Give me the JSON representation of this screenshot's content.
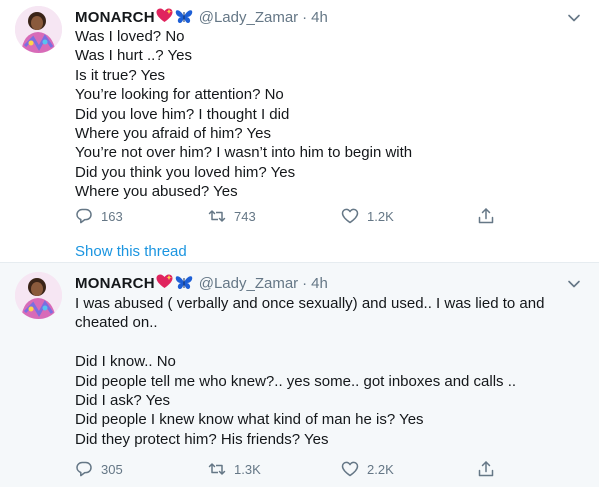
{
  "tweets": [
    {
      "author": {
        "name": "MONARCH",
        "handle": "@Lady_Zamar",
        "separator": "·",
        "time": "4h"
      },
      "body": "Was I loved? No\nWas I hurt ..? Yes\nIs it true? Yes\nYou’re looking for attention? No\nDid you love him? I thought I did\nWhere you afraid of him? Yes\nYou’re not over him? I wasn’t into him to begin with\nDid you think you loved him? Yes\nWhere you abused? Yes",
      "counts": {
        "replies": "163",
        "retweets": "743",
        "likes": "1.2K"
      },
      "show_thread": "Show this thread"
    },
    {
      "author": {
        "name": "MONARCH",
        "handle": "@Lady_Zamar",
        "separator": "·",
        "time": "4h"
      },
      "body": "I was abused ( verbally and once sexually) and used.. I was lied to and\ncheated on..\n\nDid I know.. No\nDid people tell me who knew?.. yes some.. got inboxes and calls ..\nDid I ask? Yes\nDid people I knew know what kind of man he is? Yes\nDid they protect him? His friends? Yes",
      "counts": {
        "replies": "305",
        "retweets": "1.3K",
        "likes": "2.2K"
      }
    }
  ],
  "icons": {
    "name_emoji": "sparkling-heart-icon",
    "name_emoji_2": "butterfly-icon",
    "reply": "reply-icon",
    "retweet": "retweet-icon",
    "like": "heart-icon",
    "share": "share-icon",
    "menu": "chevron-down-icon"
  },
  "colors": {
    "accent": "#1b95e0",
    "secondary_text": "#657786",
    "thread_bg": "#f5f8fa",
    "heart_emoji": "#e0245e",
    "butterfly": "#1d5fd6"
  }
}
